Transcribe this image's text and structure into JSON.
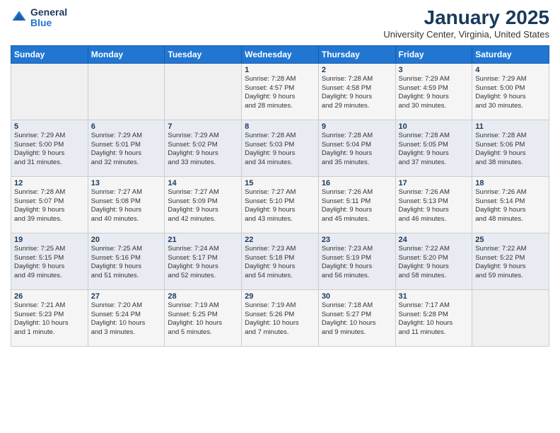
{
  "header": {
    "logo_general": "General",
    "logo_blue": "Blue",
    "title": "January 2025",
    "subtitle": "University Center, Virginia, United States"
  },
  "days_of_week": [
    "Sunday",
    "Monday",
    "Tuesday",
    "Wednesday",
    "Thursday",
    "Friday",
    "Saturday"
  ],
  "weeks": [
    [
      {
        "day": "",
        "info": ""
      },
      {
        "day": "",
        "info": ""
      },
      {
        "day": "",
        "info": ""
      },
      {
        "day": "1",
        "info": "Sunrise: 7:28 AM\nSunset: 4:57 PM\nDaylight: 9 hours\nand 28 minutes."
      },
      {
        "day": "2",
        "info": "Sunrise: 7:28 AM\nSunset: 4:58 PM\nDaylight: 9 hours\nand 29 minutes."
      },
      {
        "day": "3",
        "info": "Sunrise: 7:29 AM\nSunset: 4:59 PM\nDaylight: 9 hours\nand 30 minutes."
      },
      {
        "day": "4",
        "info": "Sunrise: 7:29 AM\nSunset: 5:00 PM\nDaylight: 9 hours\nand 30 minutes."
      }
    ],
    [
      {
        "day": "5",
        "info": "Sunrise: 7:29 AM\nSunset: 5:00 PM\nDaylight: 9 hours\nand 31 minutes."
      },
      {
        "day": "6",
        "info": "Sunrise: 7:29 AM\nSunset: 5:01 PM\nDaylight: 9 hours\nand 32 minutes."
      },
      {
        "day": "7",
        "info": "Sunrise: 7:29 AM\nSunset: 5:02 PM\nDaylight: 9 hours\nand 33 minutes."
      },
      {
        "day": "8",
        "info": "Sunrise: 7:28 AM\nSunset: 5:03 PM\nDaylight: 9 hours\nand 34 minutes."
      },
      {
        "day": "9",
        "info": "Sunrise: 7:28 AM\nSunset: 5:04 PM\nDaylight: 9 hours\nand 35 minutes."
      },
      {
        "day": "10",
        "info": "Sunrise: 7:28 AM\nSunset: 5:05 PM\nDaylight: 9 hours\nand 37 minutes."
      },
      {
        "day": "11",
        "info": "Sunrise: 7:28 AM\nSunset: 5:06 PM\nDaylight: 9 hours\nand 38 minutes."
      }
    ],
    [
      {
        "day": "12",
        "info": "Sunrise: 7:28 AM\nSunset: 5:07 PM\nDaylight: 9 hours\nand 39 minutes."
      },
      {
        "day": "13",
        "info": "Sunrise: 7:27 AM\nSunset: 5:08 PM\nDaylight: 9 hours\nand 40 minutes."
      },
      {
        "day": "14",
        "info": "Sunrise: 7:27 AM\nSunset: 5:09 PM\nDaylight: 9 hours\nand 42 minutes."
      },
      {
        "day": "15",
        "info": "Sunrise: 7:27 AM\nSunset: 5:10 PM\nDaylight: 9 hours\nand 43 minutes."
      },
      {
        "day": "16",
        "info": "Sunrise: 7:26 AM\nSunset: 5:11 PM\nDaylight: 9 hours\nand 45 minutes."
      },
      {
        "day": "17",
        "info": "Sunrise: 7:26 AM\nSunset: 5:13 PM\nDaylight: 9 hours\nand 46 minutes."
      },
      {
        "day": "18",
        "info": "Sunrise: 7:26 AM\nSunset: 5:14 PM\nDaylight: 9 hours\nand 48 minutes."
      }
    ],
    [
      {
        "day": "19",
        "info": "Sunrise: 7:25 AM\nSunset: 5:15 PM\nDaylight: 9 hours\nand 49 minutes."
      },
      {
        "day": "20",
        "info": "Sunrise: 7:25 AM\nSunset: 5:16 PM\nDaylight: 9 hours\nand 51 minutes."
      },
      {
        "day": "21",
        "info": "Sunrise: 7:24 AM\nSunset: 5:17 PM\nDaylight: 9 hours\nand 52 minutes."
      },
      {
        "day": "22",
        "info": "Sunrise: 7:23 AM\nSunset: 5:18 PM\nDaylight: 9 hours\nand 54 minutes."
      },
      {
        "day": "23",
        "info": "Sunrise: 7:23 AM\nSunset: 5:19 PM\nDaylight: 9 hours\nand 56 minutes."
      },
      {
        "day": "24",
        "info": "Sunrise: 7:22 AM\nSunset: 5:20 PM\nDaylight: 9 hours\nand 58 minutes."
      },
      {
        "day": "25",
        "info": "Sunrise: 7:22 AM\nSunset: 5:22 PM\nDaylight: 9 hours\nand 59 minutes."
      }
    ],
    [
      {
        "day": "26",
        "info": "Sunrise: 7:21 AM\nSunset: 5:23 PM\nDaylight: 10 hours\nand 1 minute."
      },
      {
        "day": "27",
        "info": "Sunrise: 7:20 AM\nSunset: 5:24 PM\nDaylight: 10 hours\nand 3 minutes."
      },
      {
        "day": "28",
        "info": "Sunrise: 7:19 AM\nSunset: 5:25 PM\nDaylight: 10 hours\nand 5 minutes."
      },
      {
        "day": "29",
        "info": "Sunrise: 7:19 AM\nSunset: 5:26 PM\nDaylight: 10 hours\nand 7 minutes."
      },
      {
        "day": "30",
        "info": "Sunrise: 7:18 AM\nSunset: 5:27 PM\nDaylight: 10 hours\nand 9 minutes."
      },
      {
        "day": "31",
        "info": "Sunrise: 7:17 AM\nSunset: 5:28 PM\nDaylight: 10 hours\nand 11 minutes."
      },
      {
        "day": "",
        "info": ""
      }
    ]
  ]
}
